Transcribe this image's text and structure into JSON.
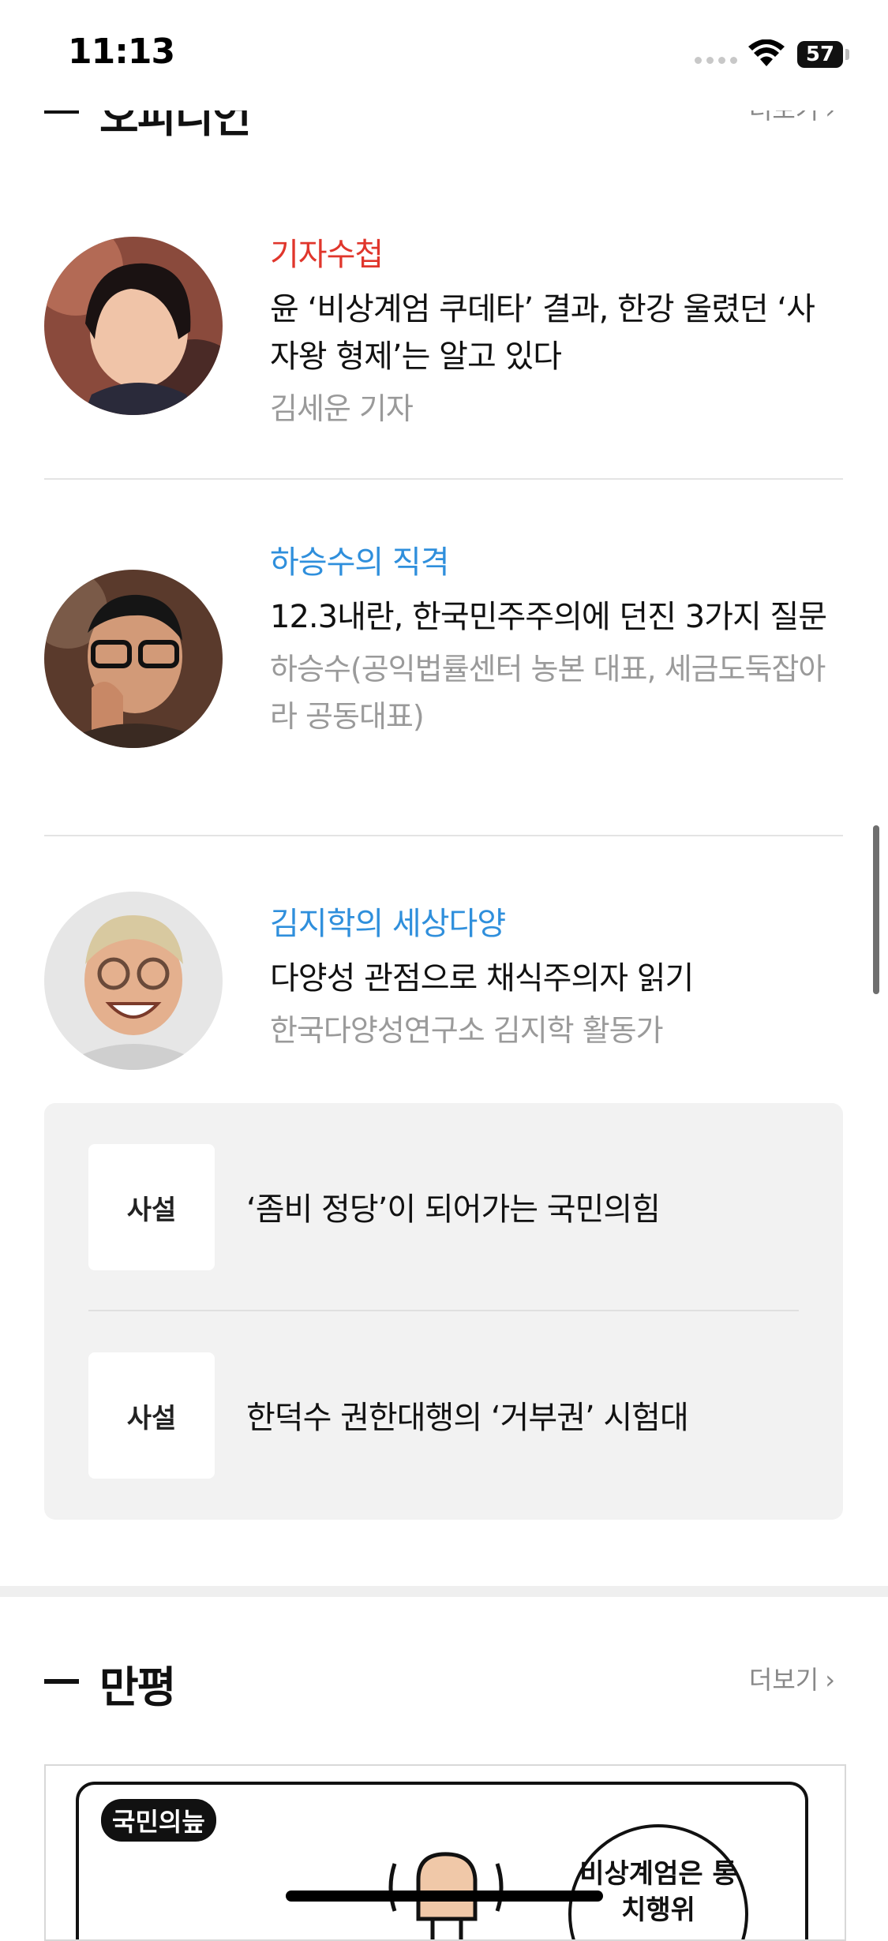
{
  "status_bar": {
    "time": "11:13",
    "battery": "57"
  },
  "opinion_section": {
    "title": "오피니언",
    "more": "더보기",
    "items": [
      {
        "column": "기자수첩",
        "column_color": "#e0362c",
        "headline": "윤 ‘비상계엄 쿠데타’ 결과, 한강 울렸던 ‘사자왕 형제’는 알고 있다",
        "byline": "김세운 기자"
      },
      {
        "column": "하승수의 직격",
        "column_color": "#2f8fdc",
        "headline": "12.3내란, 한국민주주의에 던진 3가지 질문",
        "byline": "하승수(공익법률센터 농본 대표, 세금도둑잡아라 공동대표)"
      },
      {
        "column": "김지학의 세상다양",
        "column_color": "#2f8fdc",
        "headline": "다양성 관점으로 채식주의자 읽기",
        "byline": "한국다양성연구소 김지학 활동가"
      }
    ],
    "editorials": [
      {
        "tag": "사설",
        "title": "‘좀비 정당’이 되어가는 국민의힘"
      },
      {
        "tag": "사설",
        "title": "한덕수 권한대행의 ‘거부권’ 시험대"
      }
    ]
  },
  "cartoon_section": {
    "title": "만평",
    "more": "더보기",
    "badge": "국민의늪",
    "bubble_text": "비상계엄은 통치행위"
  }
}
